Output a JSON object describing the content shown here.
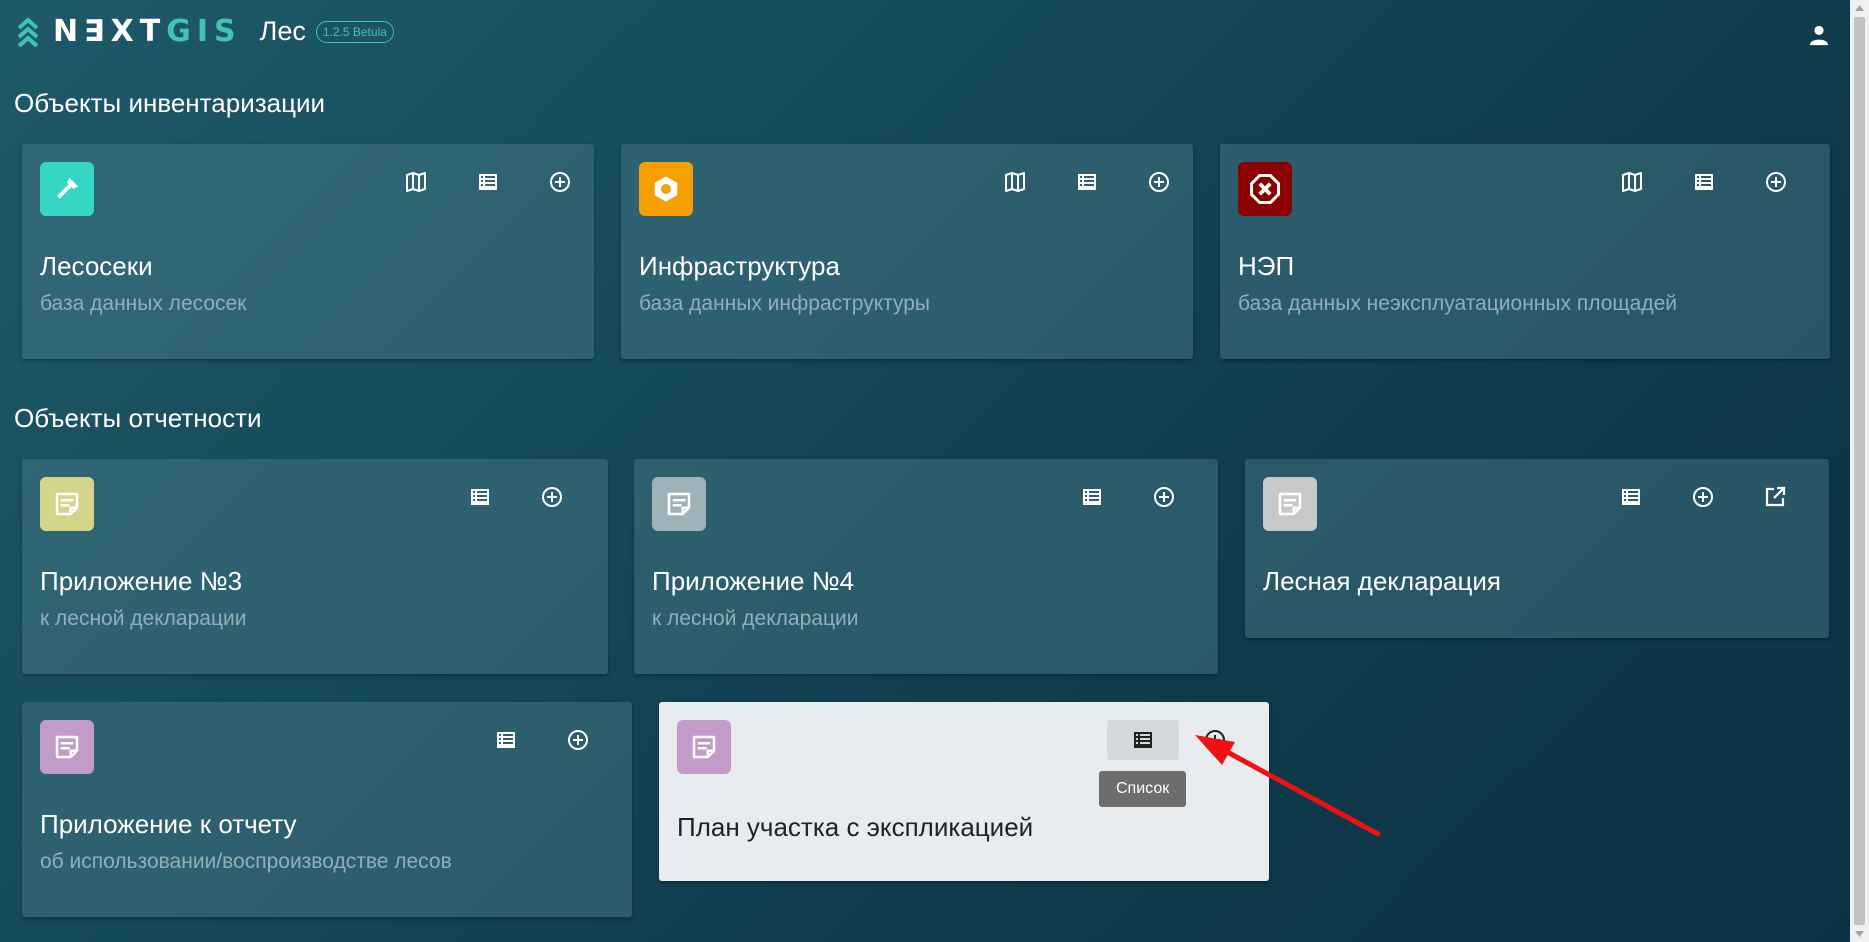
{
  "header": {
    "logo_prefix": "N∃XT",
    "logo_suffix": "GIS",
    "app_name": "Лес",
    "version": "1.2.5 Betula"
  },
  "sections": {
    "inventory_title": "Объекты инвентаризации",
    "reports_title": "Объекты отчетности"
  },
  "cards": {
    "lesoseki": {
      "title": "Лесосеки",
      "subtitle": "база данных лесосек",
      "icon": "axe-icon",
      "icon_color": "#36d6c5"
    },
    "infra": {
      "title": "Инфраструктура",
      "subtitle": "база данных инфраструктуры",
      "icon": "settings-hex-icon",
      "icon_color": "#f5a000"
    },
    "nep": {
      "title": "НЭП",
      "subtitle": "база данных неэксплуатационных площадей",
      "icon": "close-octagon-icon",
      "icon_color": "#8b0000"
    },
    "pril3": {
      "title": "Приложение №3",
      "subtitle": "к лесной декларации",
      "icon": "note-icon",
      "icon_color": "#d6d48a"
    },
    "pril4": {
      "title": "Приложение №4",
      "subtitle": "к лесной декларации",
      "icon": "note-icon",
      "icon_color": "#9fb2ba"
    },
    "decl": {
      "title": "Лесная декларация",
      "icon": "note-icon",
      "icon_color": "#c8c8c8"
    },
    "report": {
      "title": "Приложение к отчету",
      "subtitle": "об использовании/воспроизводстве лесов",
      "icon": "note-icon",
      "icon_color": "#c39bc7"
    },
    "plan": {
      "title": "План участка с экспликацией",
      "icon": "note-icon",
      "icon_color": "#c39bc7"
    }
  },
  "tooltip": {
    "text": "Список"
  },
  "colors": {
    "accent": "#3fc4b0",
    "arrow": "#ee1111"
  }
}
